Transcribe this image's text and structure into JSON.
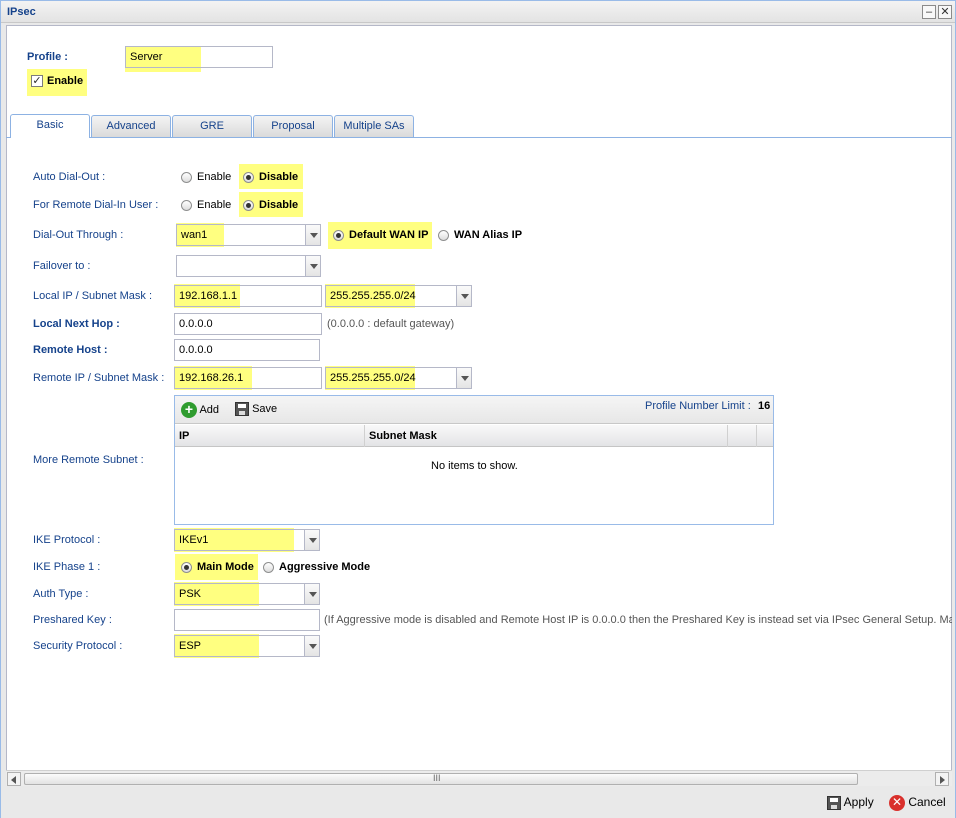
{
  "window": {
    "title": "IPsec",
    "minimize_glyph": "–",
    "close_glyph": "✕"
  },
  "profile": {
    "label": "Profile :",
    "value": "Server",
    "enable_label": "Enable",
    "enable_checked": true
  },
  "tabs": [
    {
      "label": "Basic",
      "active": true
    },
    {
      "label": "Advanced",
      "active": false
    },
    {
      "label": "GRE",
      "active": false
    },
    {
      "label": "Proposal",
      "active": false
    },
    {
      "label": "Multiple SAs",
      "active": false
    }
  ],
  "form": {
    "auto_dial_out": {
      "label": "Auto Dial-Out :",
      "opt_enable": "Enable",
      "opt_disable": "Disable",
      "selected": "Disable"
    },
    "remote_dial_in": {
      "label": "For Remote Dial-In User :",
      "opt_enable": "Enable",
      "opt_disable": "Disable",
      "selected": "Disable"
    },
    "dial_out_through": {
      "label": "Dial-Out Through :",
      "value": "wan1",
      "opt_default": "Default WAN IP",
      "opt_alias": "WAN Alias IP",
      "selected": "Default WAN IP"
    },
    "failover": {
      "label": "Failover to :",
      "value": ""
    },
    "local_ip": {
      "label": "Local IP / Subnet Mask :",
      "ip": "192.168.1.1",
      "mask": "255.255.255.0/24"
    },
    "local_next_hop": {
      "label": "Local Next Hop :",
      "value": "0.0.0.0",
      "hint": "(0.0.0.0 : default gateway)"
    },
    "remote_host": {
      "label": "Remote Host :",
      "value": "0.0.0.0"
    },
    "remote_ip": {
      "label": "Remote IP / Subnet Mask :",
      "ip": "192.168.26.1",
      "mask": "255.255.255.0/24"
    },
    "more_remote_subnet": {
      "label": "More Remote Subnet :",
      "add_label": "Add",
      "save_label": "Save",
      "limit_label": "Profile Number Limit :",
      "limit_value": "16",
      "columns": [
        "IP",
        "Subnet Mask"
      ],
      "empty_text": "No items to show."
    },
    "ike_protocol": {
      "label": "IKE Protocol :",
      "value": "IKEv1"
    },
    "ike_phase1": {
      "label": "IKE Phase 1 :",
      "opt_main": "Main Mode",
      "opt_aggressive": "Aggressive Mode",
      "selected": "Main Mode"
    },
    "auth_type": {
      "label": "Auth Type :",
      "value": "PSK"
    },
    "preshared_key": {
      "label": "Preshared Key :",
      "value": "",
      "hint": "(If Aggressive mode is disabled and Remote Host IP is 0.0.0.0 then the Preshared Key is instead set via IPsec General Setup. Ma"
    },
    "security_protocol": {
      "label": "Security Protocol :",
      "value": "ESP"
    }
  },
  "scrollbar": {
    "grip": "III"
  },
  "footer": {
    "apply_label": "Apply",
    "cancel_label": "Cancel"
  }
}
